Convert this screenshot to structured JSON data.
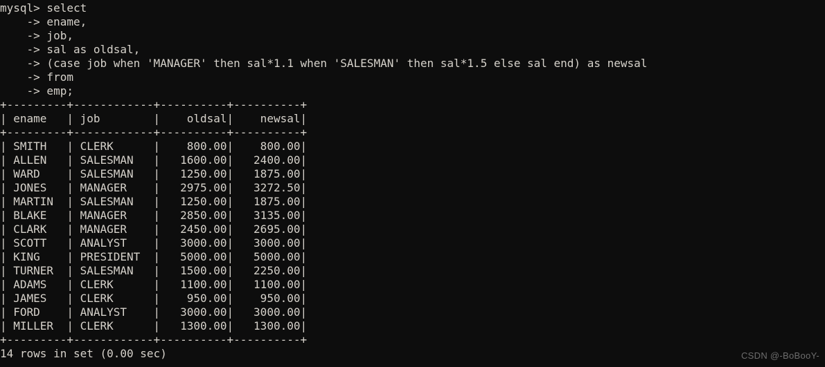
{
  "terminal": {
    "background_color": "#0d0d0d",
    "text_color": "#d6d2cb",
    "prompt": "mysql> ",
    "continuation_prompt": "    -> "
  },
  "query": {
    "lines": [
      "mysql> select",
      "    -> ename,",
      "    -> job,",
      "    -> sal as oldsal,",
      "    -> (case job when 'MANAGER' then sal*1.1 when 'SALESMAN' then sal*1.5 else sal end) as newsal",
      "    -> from",
      "    -> emp;"
    ]
  },
  "result_table": {
    "columns": [
      {
        "name": "ename",
        "width": 9,
        "align": "left"
      },
      {
        "name": "job",
        "width": 12,
        "align": "left"
      },
      {
        "name": "oldsal",
        "width": 10,
        "align": "right"
      },
      {
        "name": "newsal",
        "width": 10,
        "align": "right"
      }
    ],
    "rows": [
      {
        "ename": "SMITH",
        "job": "CLERK",
        "oldsal": "800.00",
        "newsal": "800.00"
      },
      {
        "ename": "ALLEN",
        "job": "SALESMAN",
        "oldsal": "1600.00",
        "newsal": "2400.00"
      },
      {
        "ename": "WARD",
        "job": "SALESMAN",
        "oldsal": "1250.00",
        "newsal": "1875.00"
      },
      {
        "ename": "JONES",
        "job": "MANAGER",
        "oldsal": "2975.00",
        "newsal": "3272.50"
      },
      {
        "ename": "MARTIN",
        "job": "SALESMAN",
        "oldsal": "1250.00",
        "newsal": "1875.00"
      },
      {
        "ename": "BLAKE",
        "job": "MANAGER",
        "oldsal": "2850.00",
        "newsal": "3135.00"
      },
      {
        "ename": "CLARK",
        "job": "MANAGER",
        "oldsal": "2450.00",
        "newsal": "2695.00"
      },
      {
        "ename": "SCOTT",
        "job": "ANALYST",
        "oldsal": "3000.00",
        "newsal": "3000.00"
      },
      {
        "ename": "KING",
        "job": "PRESIDENT",
        "oldsal": "5000.00",
        "newsal": "5000.00"
      },
      {
        "ename": "TURNER",
        "job": "SALESMAN",
        "oldsal": "1500.00",
        "newsal": "2250.00"
      },
      {
        "ename": "ADAMS",
        "job": "CLERK",
        "oldsal": "1100.00",
        "newsal": "1100.00"
      },
      {
        "ename": "JAMES",
        "job": "CLERK",
        "oldsal": "950.00",
        "newsal": "950.00"
      },
      {
        "ename": "FORD",
        "job": "ANALYST",
        "oldsal": "3000.00",
        "newsal": "3000.00"
      },
      {
        "ename": "MILLER",
        "job": "CLERK",
        "oldsal": "1300.00",
        "newsal": "1300.00"
      }
    ]
  },
  "status": {
    "text": "14 rows in set (0.00 sec)"
  },
  "watermark": {
    "text": "CSDN @-BoBooY-"
  }
}
